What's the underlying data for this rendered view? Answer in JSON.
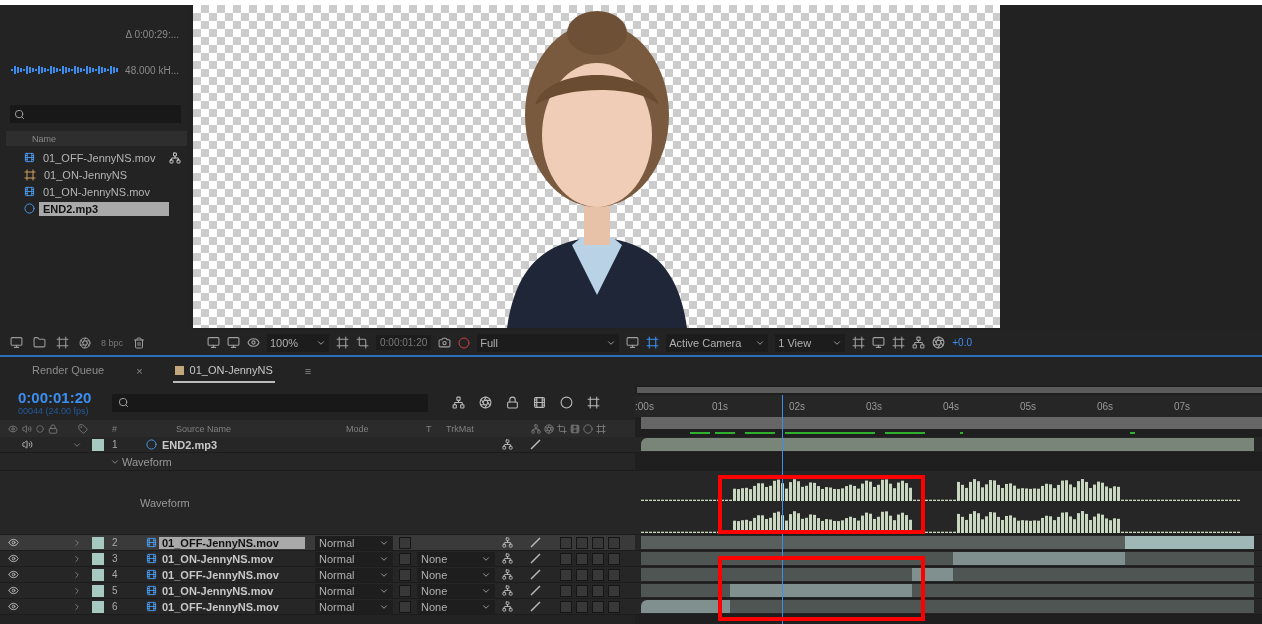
{
  "project": {
    "info": [
      {
        "kind": "text",
        "text": "Δ 0:00:29:..."
      },
      {
        "kind": "audio",
        "text": "48.000 kH..."
      }
    ],
    "column": "Name",
    "items": [
      {
        "name": "01_OFF-JennyNS.mov",
        "kind": "footage",
        "selected": false,
        "flowchart": true
      },
      {
        "name": "01_ON-JennyNS",
        "kind": "composition",
        "selected": false,
        "flowchart": false
      },
      {
        "name": "01_ON-JennyNS.mov",
        "kind": "footage",
        "selected": false,
        "flowchart": false
      },
      {
        "name": "END2.mp3",
        "kind": "audio",
        "selected": true,
        "flowchart": false
      }
    ],
    "bpc": "8 bpc"
  },
  "viewer": {
    "zoom": "100%",
    "timecode": "0:00:01:20",
    "resolution": "Full",
    "camera": "Active Camera",
    "views": "1 View",
    "exposure": "+0.0"
  },
  "timeline": {
    "tabs": [
      {
        "label": "Render Queue",
        "selected": false
      },
      {
        "label": "01_ON-JennyNS",
        "selected": true,
        "close": "×",
        "menu": "≡"
      }
    ],
    "timecode": "0:00:01:20",
    "frame_info": "00044 (24.00 fps)",
    "columns": {
      "number": "#",
      "source": "Source Name",
      "mode": "Mode",
      "t": "T",
      "trkmat": "TrkMat"
    },
    "ruler": [
      ":00s",
      "01s",
      "02s",
      "03s",
      "04s",
      "05s",
      "06s",
      "07s"
    ],
    "layers": [
      {
        "number": "1",
        "name": "END2.mp3",
        "kind": "audio",
        "expanded": true,
        "selected": false,
        "highlighted": true,
        "group": "Waveform",
        "property": "Waveform"
      },
      {
        "number": "2",
        "name": "01_OFF-JennyNS.mov",
        "kind": "footage",
        "expanded": false,
        "selected": true,
        "mode": "Normal"
      },
      {
        "number": "3",
        "name": "01_ON-JennyNS.mov",
        "kind": "footage",
        "expanded": false,
        "selected": false,
        "mode": "Normal",
        "trkmat": "None"
      },
      {
        "number": "4",
        "name": "01_OFF-JennyNS.mov",
        "kind": "footage",
        "expanded": false,
        "selected": false,
        "highlighted": true,
        "mode": "Normal",
        "trkmat": "None"
      },
      {
        "number": "5",
        "name": "01_ON-JennyNS.mov",
        "kind": "footage",
        "expanded": false,
        "selected": false,
        "highlighted": true,
        "mode": "Normal",
        "trkmat": "None"
      },
      {
        "number": "6",
        "name": "01_OFF-JennyNS.mov",
        "kind": "footage",
        "expanded": false,
        "selected": false,
        "highlighted": true,
        "mode": "Normal",
        "trkmat": "None"
      }
    ]
  }
}
